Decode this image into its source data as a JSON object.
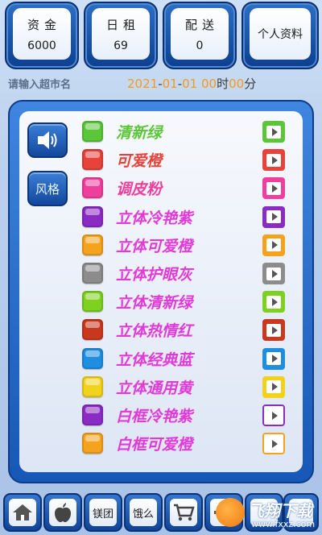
{
  "header": {
    "tiles": [
      {
        "label": "资金",
        "value": "6000"
      },
      {
        "label": "日租",
        "value": "69"
      },
      {
        "label": "配送",
        "value": "0"
      },
      {
        "label": "个人资料",
        "value": ""
      }
    ]
  },
  "store": {
    "placeholder": "请输入超市名",
    "date": {
      "year": "2021",
      "month": "01",
      "day": "01",
      "hour": "00",
      "hour_unit": "时",
      "minute": "00",
      "minute_unit": "分"
    }
  },
  "side_buttons": {
    "sound_icon": "speaker-icon",
    "style_label": "风格"
  },
  "themes": [
    {
      "name": "清新绿",
      "swatch": "#5cc63a",
      "text": "#5cc63a",
      "play_bg": "#5cc63a"
    },
    {
      "name": "可爱橙",
      "swatch": "#e8433a",
      "text": "#e8433a",
      "play_bg": "#e8433a"
    },
    {
      "name": "调皮粉",
      "swatch": "#ef3f9e",
      "text": "#ef3f9e",
      "play_bg": "#ef3f9e"
    },
    {
      "name": "立体冷艳紫",
      "swatch": "#8a2bc4",
      "text": "#e23ad8",
      "play_bg": "#8a2bc4"
    },
    {
      "name": "立体可爱橙",
      "swatch": "#f5a21c",
      "text": "#e23ad8",
      "play_bg": "#f5a21c"
    },
    {
      "name": "立体护眼灰",
      "swatch": "#8c8c8c",
      "text": "#e23ad8",
      "play_bg": "#8c8c8c"
    },
    {
      "name": "立体清新绿",
      "swatch": "#7ed11e",
      "text": "#e23ad8",
      "play_bg": "#7ed11e"
    },
    {
      "name": "立体热情红",
      "swatch": "#c8381e",
      "text": "#e23ad8",
      "play_bg": "#c8381e"
    },
    {
      "name": "立体经典蓝",
      "swatch": "#1f8de0",
      "text": "#e23ad8",
      "play_bg": "#1f8de0"
    },
    {
      "name": "立体通用黄",
      "swatch": "#f1d21c",
      "text": "#e23ad8",
      "play_bg": "#f1d21c"
    },
    {
      "name": "白框冷艳紫",
      "swatch": "#8a2bc4",
      "text": "#e23ad8",
      "play_bg": "#ffffff"
    },
    {
      "name": "白框可爱橙",
      "swatch": "#f5a21c",
      "text": "#e23ad8",
      "play_bg": "#ffffff"
    }
  ],
  "bottom_nav": [
    {
      "icon": "home-icon",
      "label": ""
    },
    {
      "icon": "apple-icon",
      "label": ""
    },
    {
      "icon": "",
      "label": "镁团"
    },
    {
      "icon": "",
      "label": "饿么"
    },
    {
      "icon": "cart-icon",
      "label": ""
    },
    {
      "icon": "gear-icon",
      "label": ""
    }
  ],
  "watermark": {
    "line1": "飞翔下载",
    "line2": "www.fxxz.com"
  }
}
